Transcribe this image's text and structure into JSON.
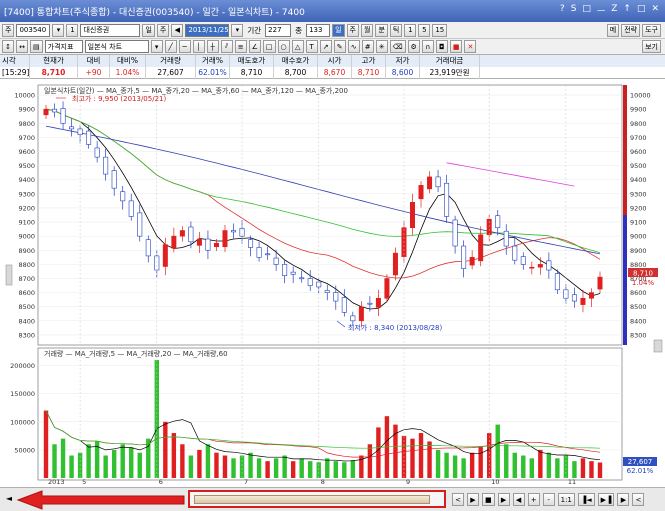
{
  "window": {
    "title": "[7400] 통합차트(주식종합) - 대신증권(003540) - 일간 - 일본식차트) - 7400",
    "controls": [
      "?",
      "S",
      "□",
      "ㅡ",
      "Z",
      "↑",
      "□",
      "✕"
    ]
  },
  "toolbar1": {
    "code": "003540",
    "code_suffix": "1",
    "stock_name": "대신증권",
    "period_btns": [
      "일",
      "주",
      "월",
      "분",
      "틱"
    ],
    "date": "2013/11/25",
    "period_label": "기간",
    "period_value": "227",
    "count_value": "133",
    "count_label": "종",
    "unit_btns": [
      "일",
      "주",
      "월",
      "분",
      "틱",
      "1",
      "5",
      "15"
    ],
    "right_btns": [
      "메",
      "전략",
      "도구"
    ]
  },
  "toolbar2": {
    "indicator_label": "가격지표",
    "chart_type": "일본식 차트",
    "view_btn": "보기"
  },
  "quote": {
    "headers": [
      "시각",
      "현재가",
      "대비",
      "대비%",
      "거래량",
      "거래%",
      "매도호가",
      "매수호가",
      "시가",
      "고가",
      "저가",
      "거래대금"
    ],
    "values": [
      "[15:29]",
      "8,710",
      "+90",
      "1.04%",
      "27,607",
      "62.01%",
      "8,710",
      "8,700",
      "8,670",
      "8,710",
      "8,600",
      "23,919만원"
    ]
  },
  "chart_data": [
    {
      "type": "candlestick",
      "legend": "일본식차트(일간) — MA_종가,5 — MA_종가,20 — MA_종가,60 — MA_종가,120 — MA_종가,200",
      "annotations": [
        {
          "text": "최고가 : 9,950 (2013/05/21)"
        },
        {
          "text": "최저가 : 8,340 (2013/08/28)"
        }
      ],
      "ylim": [
        8250,
        10050
      ],
      "y_ticks": [
        10000,
        9900,
        9800,
        9700,
        9600,
        9500,
        9400,
        9300,
        9200,
        9100,
        9000,
        8900,
        8800,
        8700,
        8600,
        8500,
        8400,
        8300
      ],
      "right_tags": [
        {
          "text": "8,710"
        },
        {
          "text": "1.04%"
        }
      ],
      "close": [
        9900,
        9880,
        9800,
        9760,
        9720,
        9650,
        9560,
        9440,
        9340,
        9250,
        9140,
        9000,
        8860,
        8760,
        8940,
        9000,
        9040,
        8960,
        8980,
        8900,
        8950,
        9040,
        9030,
        9000,
        8920,
        8850,
        8870,
        8800,
        8720,
        8730,
        8700,
        8650,
        8640,
        8600,
        8540,
        8460,
        8400,
        8500,
        8520,
        8560,
        8700,
        8880,
        9060,
        9240,
        9360,
        9420,
        9350,
        9140,
        8930,
        8770,
        8850,
        9010,
        9120,
        9060,
        8930,
        8830,
        8800,
        8780,
        8800,
        8760,
        8620,
        8560,
        8540,
        8560,
        8600,
        8710
      ],
      "ma_colors": {
        "ma5": "#000000",
        "ma20": "#e03030",
        "ma60": "#30c030",
        "ma120": "#3040b0",
        "ma200": "#e040e0"
      }
    },
    {
      "type": "bar",
      "legend": "거래량 — MA_거래량,5 — MA_거래량,20 — MA_거래량,60",
      "ylim": [
        0,
        210000
      ],
      "y_ticks": [
        50000,
        100000,
        150000,
        200000
      ],
      "y_tick_labels": [
        "50000",
        "100000",
        "150000",
        "200000"
      ],
      "right_tags": [
        {
          "text": "27,607"
        },
        {
          "text": "62.01%"
        }
      ],
      "x_tick_labels": [
        "2013",
        "5",
        "6",
        "7",
        "8",
        "9",
        "10",
        "11"
      ],
      "volume": [
        120000,
        60000,
        70000,
        40000,
        45000,
        60000,
        65000,
        40000,
        50000,
        60000,
        55000,
        45000,
        70000,
        210000,
        100000,
        80000,
        60000,
        40000,
        50000,
        60000,
        45000,
        40000,
        35000,
        40000,
        45000,
        35000,
        30000,
        35000,
        40000,
        30000,
        35000,
        30000,
        28000,
        35000,
        30000,
        28000,
        32000,
        40000,
        60000,
        90000,
        110000,
        95000,
        75000,
        70000,
        80000,
        65000,
        50000,
        45000,
        40000,
        35000,
        45000,
        55000,
        80000,
        95000,
        60000,
        45000,
        40000,
        35000,
        50000,
        45000,
        35000,
        40000,
        30000,
        35000,
        30000,
        27607
      ]
    }
  ],
  "bottombar": {
    "left_arrow": "◄",
    "right_btns": [
      "<",
      "▶",
      "■",
      "▶",
      "◀",
      "+",
      "-",
      "1:1",
      "▐◄",
      "▶▐",
      "▶",
      "<"
    ]
  }
}
